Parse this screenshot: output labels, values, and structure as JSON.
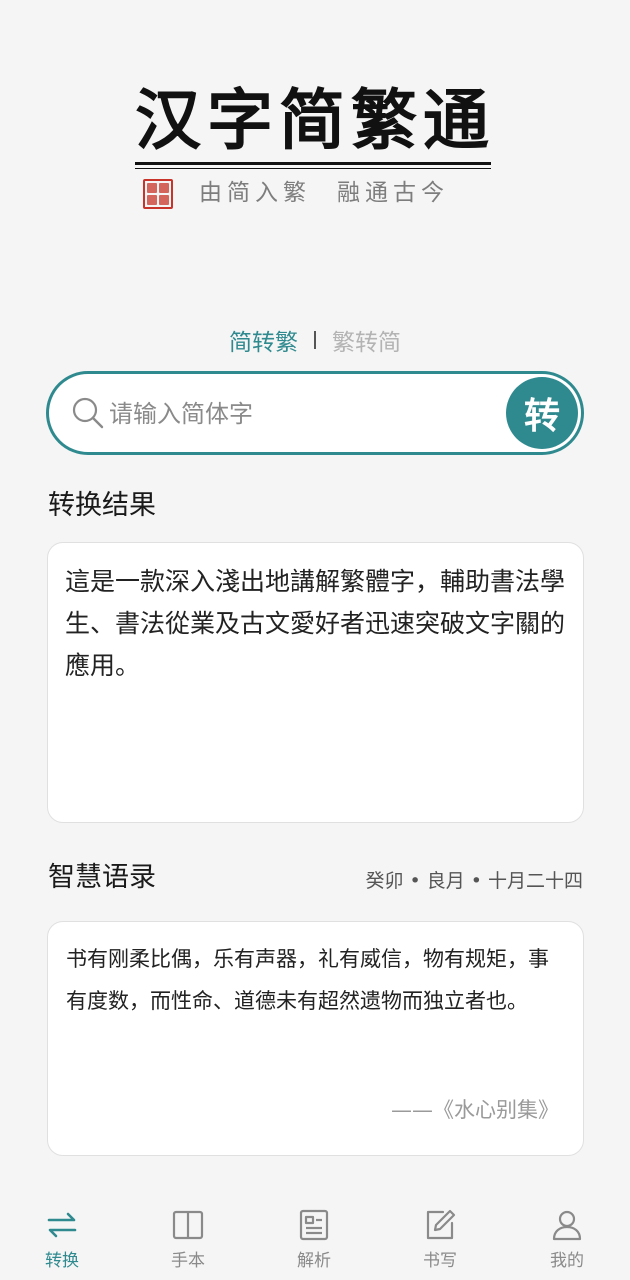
{
  "logo": {
    "title": "汉字简繁通",
    "subtitle_1": "由简入繁",
    "subtitle_2": "融通古今"
  },
  "mode": {
    "active": "简转繁",
    "inactive": "繁转简"
  },
  "search": {
    "placeholder": "请输入简体字",
    "value": "",
    "button_label": "转"
  },
  "result": {
    "title": "转换结果",
    "text": "這是一款深入淺出地講解繁體字，輔助書法學生、書法從業及古文愛好者迅速突破文字關的應用。"
  },
  "quote": {
    "title": "智慧语录",
    "date": [
      "癸卯",
      "良月",
      "十月二十四"
    ],
    "date_separator": "•",
    "text": "书有刚柔比偶，乐有声器，礼有威信，物有规矩，事有度数，而性命、道德未有超然遗物而独立者也。",
    "source": "——《水心别集》"
  },
  "nav": {
    "items": [
      {
        "label": "转换",
        "icon": "swap-icon",
        "active": true
      },
      {
        "label": "手本",
        "icon": "book-icon",
        "active": false
      },
      {
        "label": "解析",
        "icon": "analysis-icon",
        "active": false
      },
      {
        "label": "书写",
        "icon": "edit-icon",
        "active": false
      },
      {
        "label": "我的",
        "icon": "user-icon",
        "active": false
      }
    ]
  },
  "colors": {
    "accent": "#2f8a8f",
    "background": "#f5f5f5",
    "seal": "#c8342a",
    "inactive": "#8a8a8a"
  }
}
